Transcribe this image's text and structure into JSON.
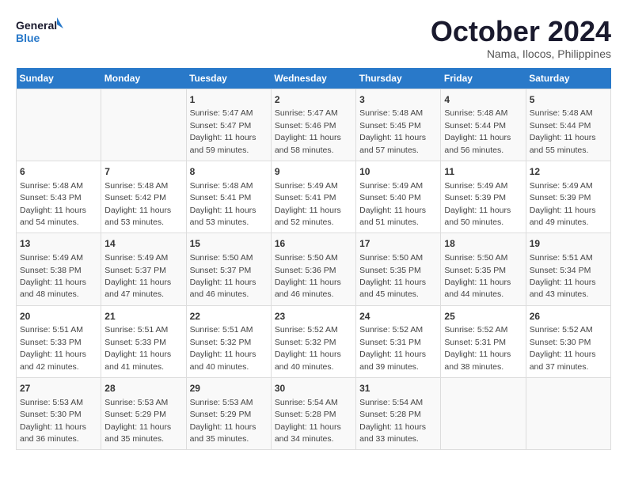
{
  "logo": {
    "line1": "General",
    "line2": "Blue"
  },
  "title": "October 2024",
  "subtitle": "Nama, Ilocos, Philippines",
  "weekdays": [
    "Sunday",
    "Monday",
    "Tuesday",
    "Wednesday",
    "Thursday",
    "Friday",
    "Saturday"
  ],
  "weeks": [
    [
      {
        "day": "",
        "info": ""
      },
      {
        "day": "",
        "info": ""
      },
      {
        "day": "1",
        "info": "Sunrise: 5:47 AM\nSunset: 5:47 PM\nDaylight: 11 hours and 59 minutes."
      },
      {
        "day": "2",
        "info": "Sunrise: 5:47 AM\nSunset: 5:46 PM\nDaylight: 11 hours and 58 minutes."
      },
      {
        "day": "3",
        "info": "Sunrise: 5:48 AM\nSunset: 5:45 PM\nDaylight: 11 hours and 57 minutes."
      },
      {
        "day": "4",
        "info": "Sunrise: 5:48 AM\nSunset: 5:44 PM\nDaylight: 11 hours and 56 minutes."
      },
      {
        "day": "5",
        "info": "Sunrise: 5:48 AM\nSunset: 5:44 PM\nDaylight: 11 hours and 55 minutes."
      }
    ],
    [
      {
        "day": "6",
        "info": "Sunrise: 5:48 AM\nSunset: 5:43 PM\nDaylight: 11 hours and 54 minutes."
      },
      {
        "day": "7",
        "info": "Sunrise: 5:48 AM\nSunset: 5:42 PM\nDaylight: 11 hours and 53 minutes."
      },
      {
        "day": "8",
        "info": "Sunrise: 5:48 AM\nSunset: 5:41 PM\nDaylight: 11 hours and 53 minutes."
      },
      {
        "day": "9",
        "info": "Sunrise: 5:49 AM\nSunset: 5:41 PM\nDaylight: 11 hours and 52 minutes."
      },
      {
        "day": "10",
        "info": "Sunrise: 5:49 AM\nSunset: 5:40 PM\nDaylight: 11 hours and 51 minutes."
      },
      {
        "day": "11",
        "info": "Sunrise: 5:49 AM\nSunset: 5:39 PM\nDaylight: 11 hours and 50 minutes."
      },
      {
        "day": "12",
        "info": "Sunrise: 5:49 AM\nSunset: 5:39 PM\nDaylight: 11 hours and 49 minutes."
      }
    ],
    [
      {
        "day": "13",
        "info": "Sunrise: 5:49 AM\nSunset: 5:38 PM\nDaylight: 11 hours and 48 minutes."
      },
      {
        "day": "14",
        "info": "Sunrise: 5:49 AM\nSunset: 5:37 PM\nDaylight: 11 hours and 47 minutes."
      },
      {
        "day": "15",
        "info": "Sunrise: 5:50 AM\nSunset: 5:37 PM\nDaylight: 11 hours and 46 minutes."
      },
      {
        "day": "16",
        "info": "Sunrise: 5:50 AM\nSunset: 5:36 PM\nDaylight: 11 hours and 46 minutes."
      },
      {
        "day": "17",
        "info": "Sunrise: 5:50 AM\nSunset: 5:35 PM\nDaylight: 11 hours and 45 minutes."
      },
      {
        "day": "18",
        "info": "Sunrise: 5:50 AM\nSunset: 5:35 PM\nDaylight: 11 hours and 44 minutes."
      },
      {
        "day": "19",
        "info": "Sunrise: 5:51 AM\nSunset: 5:34 PM\nDaylight: 11 hours and 43 minutes."
      }
    ],
    [
      {
        "day": "20",
        "info": "Sunrise: 5:51 AM\nSunset: 5:33 PM\nDaylight: 11 hours and 42 minutes."
      },
      {
        "day": "21",
        "info": "Sunrise: 5:51 AM\nSunset: 5:33 PM\nDaylight: 11 hours and 41 minutes."
      },
      {
        "day": "22",
        "info": "Sunrise: 5:51 AM\nSunset: 5:32 PM\nDaylight: 11 hours and 40 minutes."
      },
      {
        "day": "23",
        "info": "Sunrise: 5:52 AM\nSunset: 5:32 PM\nDaylight: 11 hours and 40 minutes."
      },
      {
        "day": "24",
        "info": "Sunrise: 5:52 AM\nSunset: 5:31 PM\nDaylight: 11 hours and 39 minutes."
      },
      {
        "day": "25",
        "info": "Sunrise: 5:52 AM\nSunset: 5:31 PM\nDaylight: 11 hours and 38 minutes."
      },
      {
        "day": "26",
        "info": "Sunrise: 5:52 AM\nSunset: 5:30 PM\nDaylight: 11 hours and 37 minutes."
      }
    ],
    [
      {
        "day": "27",
        "info": "Sunrise: 5:53 AM\nSunset: 5:30 PM\nDaylight: 11 hours and 36 minutes."
      },
      {
        "day": "28",
        "info": "Sunrise: 5:53 AM\nSunset: 5:29 PM\nDaylight: 11 hours and 35 minutes."
      },
      {
        "day": "29",
        "info": "Sunrise: 5:53 AM\nSunset: 5:29 PM\nDaylight: 11 hours and 35 minutes."
      },
      {
        "day": "30",
        "info": "Sunrise: 5:54 AM\nSunset: 5:28 PM\nDaylight: 11 hours and 34 minutes."
      },
      {
        "day": "31",
        "info": "Sunrise: 5:54 AM\nSunset: 5:28 PM\nDaylight: 11 hours and 33 minutes."
      },
      {
        "day": "",
        "info": ""
      },
      {
        "day": "",
        "info": ""
      }
    ]
  ]
}
